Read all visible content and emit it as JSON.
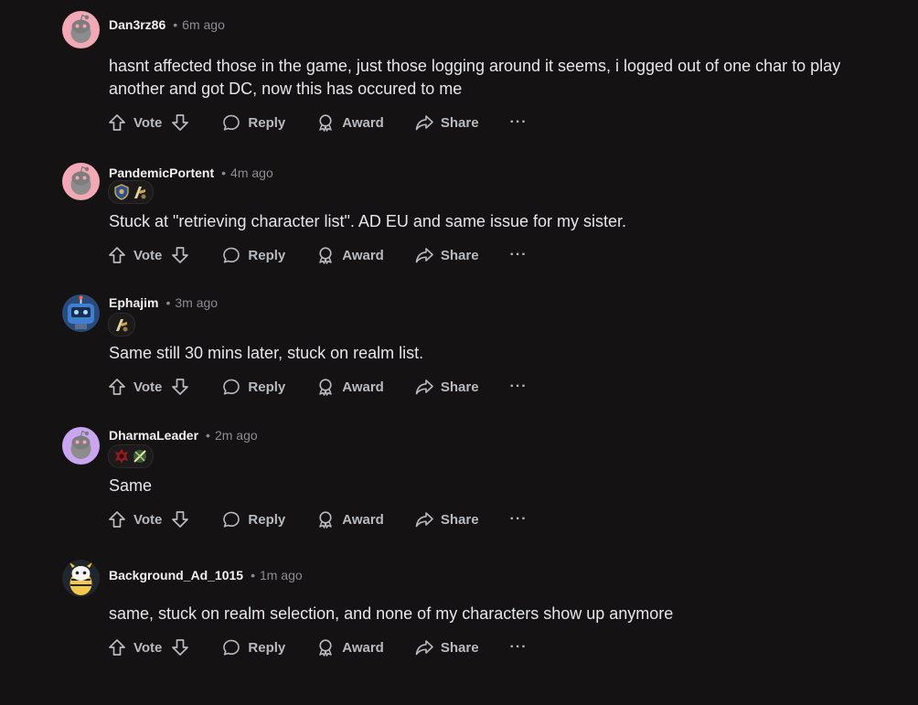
{
  "actions": {
    "vote": "Vote",
    "reply": "Reply",
    "award": "Award",
    "share": "Share",
    "more": "···"
  },
  "colors": {
    "background": "#151214",
    "author": "#f2f2f2",
    "muted": "#8a8c8f",
    "action": "#b8babd"
  },
  "comments": [
    {
      "author": "Dan3rz86",
      "separator": "•",
      "time": "6m ago",
      "avatar": "snoo-pink-avatar",
      "flairs": [],
      "text": "hasnt affected those in the game, just those logging around it seems, i logged out of one char to play another and got DC, now this has occured to me"
    },
    {
      "author": "PandemicPortent",
      "separator": "•",
      "time": "4m ago",
      "avatar": "snoo-pink-avatar",
      "flairs": [
        "alliance-crest-icon",
        "class-emblem-icon"
      ],
      "text": "Stuck at \"retrieving character list\". AD EU and same issue for my sister."
    },
    {
      "author": "Ephajim",
      "separator": "•",
      "time": "3m ago",
      "avatar": "robot-snoo-avatar",
      "flairs": [
        "class-emblem-icon"
      ],
      "text": "Same still 30 mins later, stuck on realm list."
    },
    {
      "author": "DharmaLeader",
      "separator": "•",
      "time": "2m ago",
      "avatar": "snoo-purple-avatar",
      "flairs": [
        "horde-crest-icon",
        "rogue-emblem-icon"
      ],
      "text": "Same"
    },
    {
      "author": "Background_Ad_1015",
      "separator": "•",
      "time": "1m ago",
      "avatar": "costume-snoo-avatar",
      "flairs": [],
      "text": "same, stuck on realm selection, and none of my characters show up anymore"
    }
  ]
}
